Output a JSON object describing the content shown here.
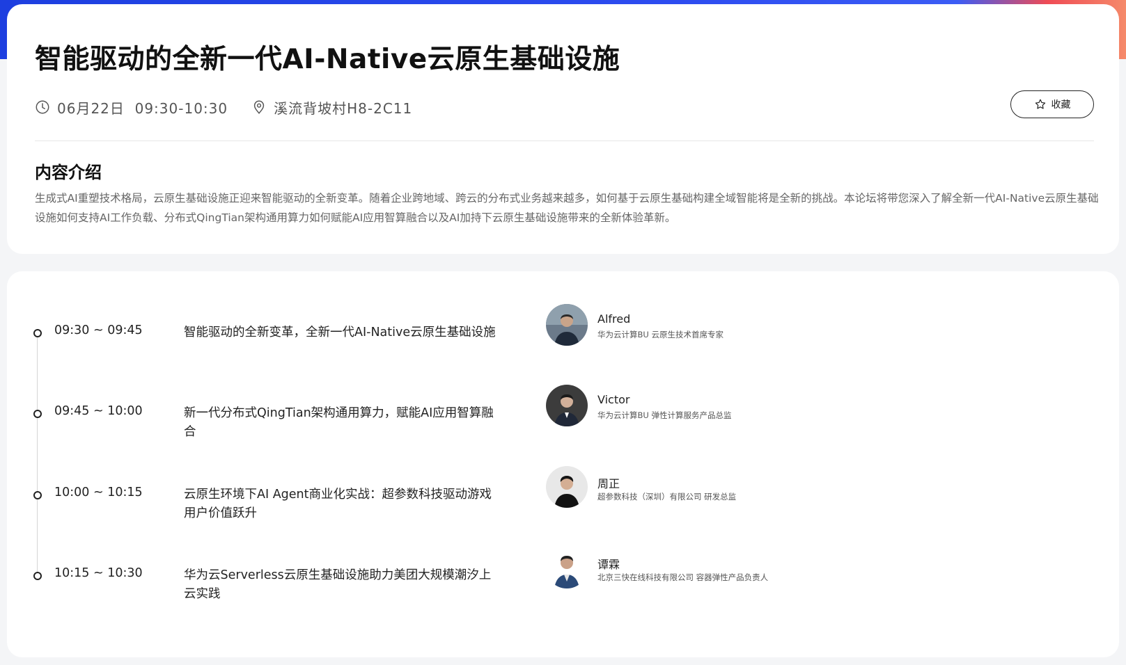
{
  "header": {
    "title": "智能驱动的全新一代AI-Native云原生基础设施",
    "datetime": "06月22日  09:30-10:30",
    "location": "溪流背坡村H8-2C11",
    "favorite_label": "收藏"
  },
  "intro": {
    "heading": "内容介绍",
    "text": "生成式AI重塑技术格局，云原生基础设施正迎来智能驱动的全新变革。随着企业跨地域、跨云的分布式业务越来越多，如何基于云原生基础构建全域智能将是全新的挑战。本论坛将带您深入了解全新一代AI-Native云原生基础设施如何支持AI工作负载、分布式QingTian架构通用算力如何赋能AI应用智算融合以及AI加持下云原生基础设施带来的全新体验革新。"
  },
  "agenda": [
    {
      "time": "09:30 ~ 09:45",
      "topic": "智能驱动的全新变革，全新一代AI-Native云原生基础设施",
      "speaker": "Alfred",
      "speaker_title": "华为云计算BU 云原生技术首席专家"
    },
    {
      "time": "09:45 ~ 10:00",
      "topic": "新一代分布式QingTian架构通用算力，赋能AI应用智算融合",
      "speaker": "Victor",
      "speaker_title": "华为云计算BU 弹性计算服务产品总监"
    },
    {
      "time": "10:00 ~ 10:15",
      "topic": "云原生环境下AI Agent商业化实战：超参数科技驱动游戏用户价值跃升",
      "speaker": "周正",
      "speaker_title": "超参数科技（深圳）有限公司 研发总监"
    },
    {
      "time": "10:15 ~ 10:30",
      "topic": "华为云Serverless云原生基础设施助力美团大规模潮汐上云实践",
      "speaker": "谭霖",
      "speaker_title": "北京三快在线科技有限公司 容器弹性产品负责人"
    }
  ],
  "icons": {
    "clock": "clock-icon",
    "location": "location-pin-icon",
    "star": "star-icon"
  }
}
